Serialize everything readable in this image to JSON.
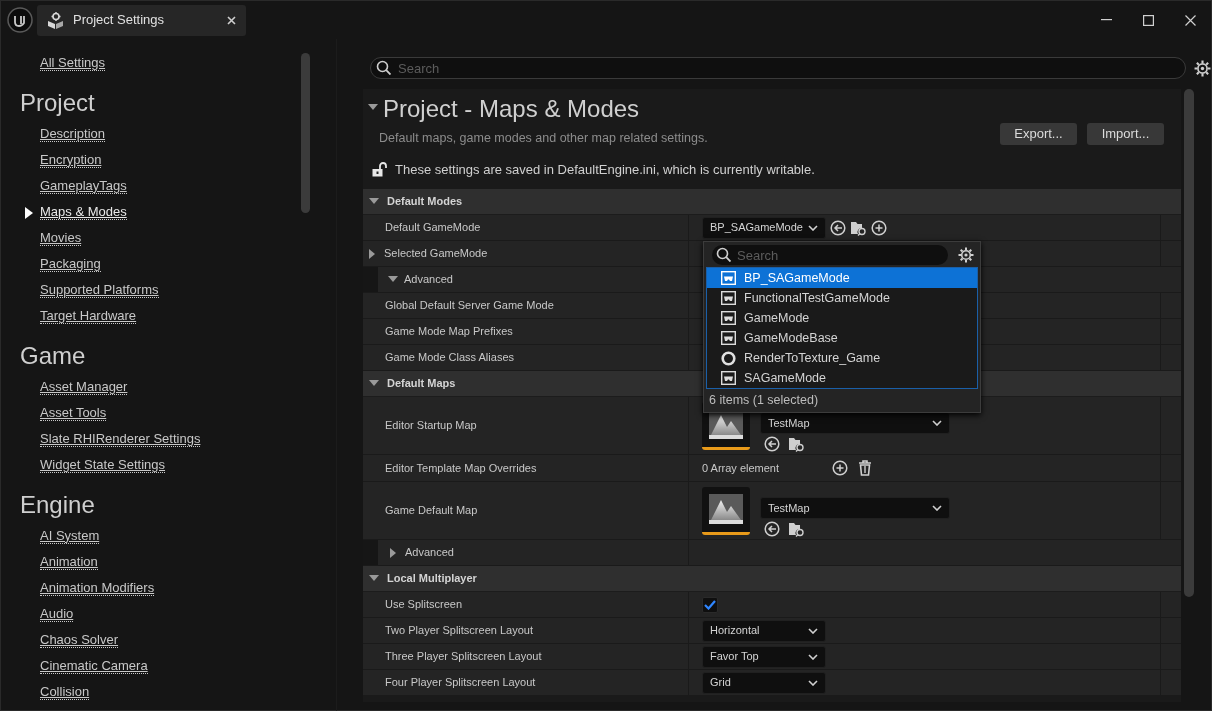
{
  "window": {
    "title": "Project Settings"
  },
  "sidebar": {
    "top_link": "All Settings",
    "categories": [
      {
        "heading": "Project",
        "items": [
          {
            "label": "Description",
            "selected": false
          },
          {
            "label": "Encryption",
            "selected": false
          },
          {
            "label": "GameplayTags",
            "selected": false
          },
          {
            "label": "Maps & Modes",
            "selected": true
          },
          {
            "label": "Movies",
            "selected": false
          },
          {
            "label": "Packaging",
            "selected": false
          },
          {
            "label": "Supported Platforms",
            "selected": false
          },
          {
            "label": "Target Hardware",
            "selected": false
          }
        ]
      },
      {
        "heading": "Game",
        "items": [
          {
            "label": "Asset Manager",
            "selected": false
          },
          {
            "label": "Asset Tools",
            "selected": false
          },
          {
            "label": "Slate RHIRenderer Settings",
            "selected": false
          },
          {
            "label": "Widget State Settings",
            "selected": false
          }
        ]
      },
      {
        "heading": "Engine",
        "items": [
          {
            "label": "AI System",
            "selected": false
          },
          {
            "label": "Animation",
            "selected": false
          },
          {
            "label": "Animation Modifiers",
            "selected": false
          },
          {
            "label": "Audio",
            "selected": false
          },
          {
            "label": "Chaos Solver",
            "selected": false
          },
          {
            "label": "Cinematic Camera",
            "selected": false
          },
          {
            "label": "Collision",
            "selected": false
          }
        ]
      }
    ]
  },
  "search": {
    "placeholder": "Search"
  },
  "page": {
    "title": "Project - Maps & Modes",
    "description": "Default maps, game modes and other map related settings.",
    "notice": "These settings are saved in DefaultEngine.ini, which is currently writable.",
    "buttons": [
      "Export...",
      "Import..."
    ]
  },
  "sections": [
    {
      "title": "Default Modes",
      "expanded": true,
      "rows": [
        {
          "kind": "class_picker",
          "label": "Default GameMode",
          "value": "BP_SAGameMode"
        },
        {
          "kind": "property",
          "label": "Selected GameMode",
          "expanded": false
        },
        {
          "kind": "group",
          "label": "Advanced",
          "expanded": true
        },
        {
          "kind": "property",
          "label": "Global Default Server Game Mode"
        },
        {
          "kind": "property",
          "label": "Game Mode Map Prefixes"
        },
        {
          "kind": "property",
          "label": "Game Mode Class Aliases"
        }
      ]
    },
    {
      "title": "Default Maps",
      "expanded": true,
      "rows": [
        {
          "kind": "asset",
          "label": "Editor Startup Map",
          "value": "TestMap"
        },
        {
          "kind": "array",
          "label": "Editor Template Map Overrides",
          "value": "0 Array element"
        },
        {
          "kind": "asset",
          "label": "Game Default Map",
          "value": "TestMap"
        },
        {
          "kind": "group",
          "label": "Advanced",
          "expanded": false
        }
      ]
    },
    {
      "title": "Local Multiplayer",
      "expanded": true,
      "rows": [
        {
          "kind": "checkbox",
          "label": "Use Splitscreen",
          "checked": true
        },
        {
          "kind": "enum",
          "label": "Two Player Splitscreen Layout",
          "value": "Horizontal"
        },
        {
          "kind": "enum",
          "label": "Three Player Splitscreen Layout",
          "value": "Favor Top"
        },
        {
          "kind": "enum",
          "label": "Four Player Splitscreen Layout",
          "value": "Grid"
        }
      ]
    }
  ],
  "picker_popup": {
    "placeholder": "Search",
    "items": [
      {
        "label": "BP_SAGameMode",
        "kind": "gamemode",
        "selected": true
      },
      {
        "label": "FunctionalTestGameMode",
        "kind": "gamemode",
        "selected": false
      },
      {
        "label": "GameMode",
        "kind": "gamemode",
        "selected": false
      },
      {
        "label": "GameModeBase",
        "kind": "gamemode",
        "selected": false
      },
      {
        "label": "RenderToTexture_Game",
        "kind": "object",
        "selected": false
      },
      {
        "label": "SAGameMode",
        "kind": "gamemode",
        "selected": false
      }
    ],
    "footer": "6 items (1 selected)"
  }
}
